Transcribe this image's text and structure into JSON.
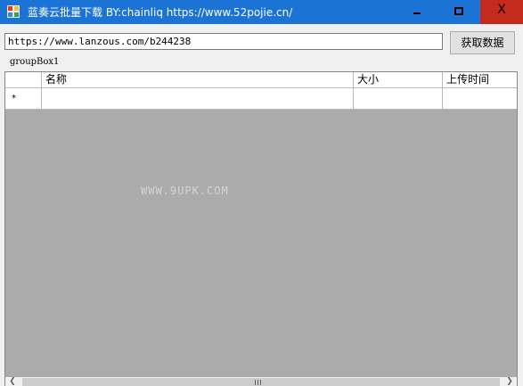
{
  "window": {
    "title": "蓝奏云批量下载 BY:chainliq https://www.52pojie.cn/",
    "close_glyph": "X"
  },
  "url_input": {
    "value": "https://www.lanzous.com/b244238"
  },
  "toolbar": {
    "fetch_label": "获取数据"
  },
  "groupbox": {
    "label": "groupBox1"
  },
  "grid": {
    "columns": [
      "名称",
      "大小",
      "上传时间"
    ],
    "new_row_marker": "*",
    "background_color": "#ababab"
  },
  "watermark": {
    "text": "WWW.9UPK.COM"
  },
  "colors": {
    "titlebar": "#1c73d6",
    "close_hover": "#c42b1c"
  }
}
